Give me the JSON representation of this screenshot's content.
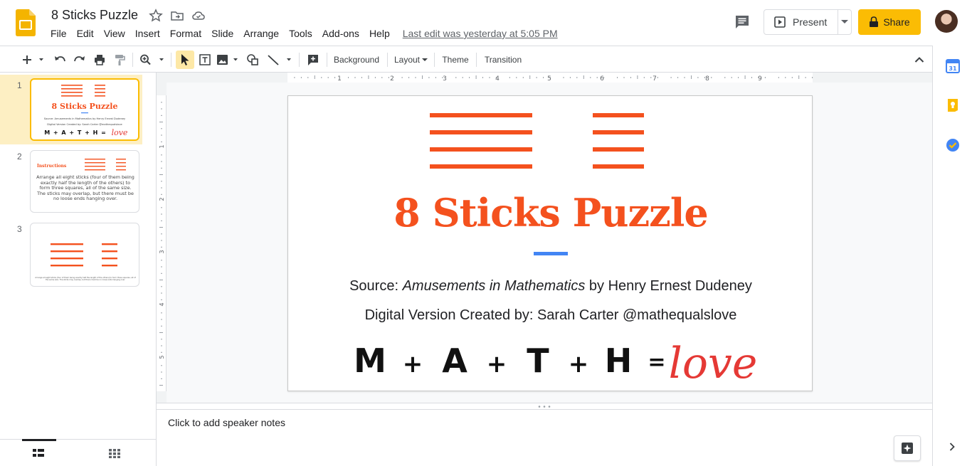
{
  "header": {
    "title": "8 Sticks Puzzle",
    "menus": [
      "File",
      "Edit",
      "View",
      "Insert",
      "Format",
      "Slide",
      "Arrange",
      "Tools",
      "Add-ons",
      "Help"
    ],
    "last_edit": "Last edit was yesterday at 5:05 PM",
    "present_label": "Present",
    "share_label": "Share"
  },
  "toolbar": {
    "background_label": "Background",
    "layout_label": "Layout",
    "theme_label": "Theme",
    "transition_label": "Transition"
  },
  "ruler": {
    "h_labels": [
      "1",
      "2",
      "3",
      "4",
      "5",
      "6",
      "7",
      "8",
      "9"
    ],
    "v_labels": [
      "1",
      "2",
      "3",
      "4",
      "5"
    ]
  },
  "filmstrip": {
    "slides": [
      {
        "number": "1",
        "title": "8 Sticks Puzzle",
        "source": "Source: Amusements in Mathematics by Henry Ernest Dudeney",
        "credit": "Digital Version Created by: Sarah Carter @mathequalslove",
        "math": "M + A + T + H =",
        "love": "love"
      },
      {
        "number": "2",
        "heading": "Instructions",
        "body": "Arrange all eight sticks (four of them being exactly half the length of the others) to form three squares, all of the same size. The sticks may overlap, but there must be no loose ends hanging over."
      },
      {
        "number": "3",
        "caption": "Arrange all eight sticks (four of them being exactly half the length of the others) to form three squares, all of the same size. The sticks may overlap, but there must be no loose ends hanging over."
      }
    ]
  },
  "slide": {
    "title": "8 Sticks Puzzle",
    "source_prefix": "Source: ",
    "source_book": "Amusements in Mathematics",
    "source_suffix": " by Henry Ernest Dudeney",
    "credit": "Digital Version Created by: Sarah Carter @mathequalslove",
    "math_letters": [
      "M",
      "A",
      "T",
      "H"
    ],
    "plus": "+",
    "equals": "=",
    "love": "love"
  },
  "notes": {
    "placeholder": "Click to add speaker notes"
  },
  "colors": {
    "accent_orange": "#f4511e",
    "accent_blue": "#4285f4",
    "share_yellow": "#fbbc04",
    "love_red": "#e53935"
  }
}
